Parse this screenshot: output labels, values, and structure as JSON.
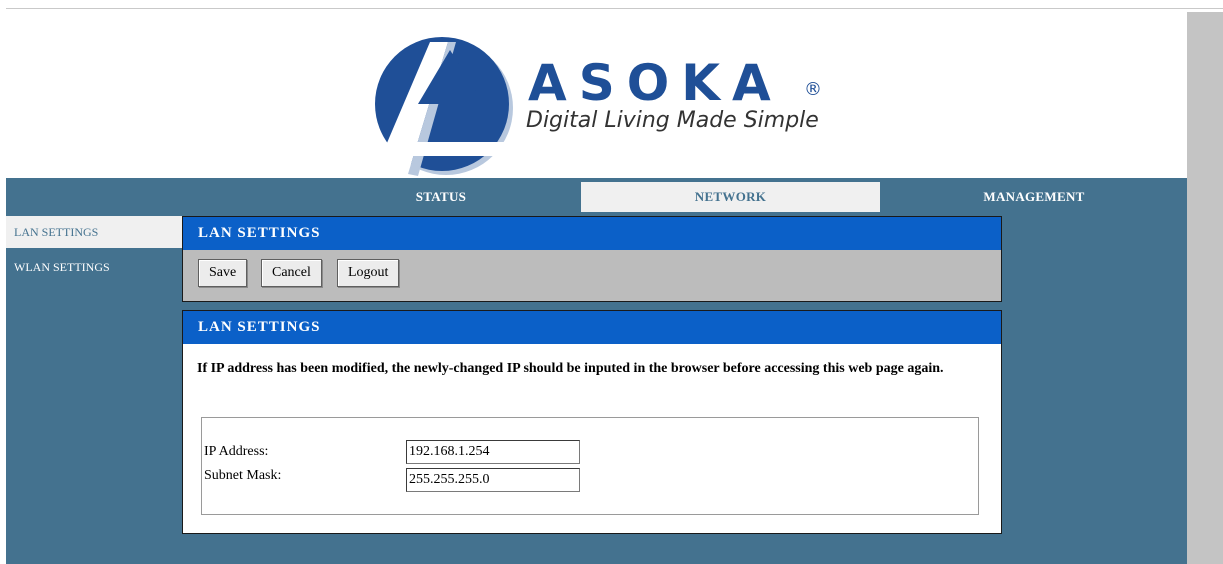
{
  "brand": {
    "name": "ASOKA",
    "registered": "®",
    "tagline": "Digital Living Made Simple",
    "primary_color": "#1f4f97",
    "shadow_color": "#b8c8de"
  },
  "nav": {
    "tabs": [
      {
        "label": "STATUS",
        "active": false
      },
      {
        "label": "NETWORK",
        "active": true
      },
      {
        "label": "MANAGEMENT",
        "active": false
      }
    ]
  },
  "sidebar": {
    "items": [
      {
        "label": "LAN SETTINGS",
        "active": true
      },
      {
        "label": "WLAN SETTINGS",
        "active": false
      }
    ]
  },
  "toolbar": {
    "title": "LAN SETTINGS",
    "save_label": "Save",
    "cancel_label": "Cancel",
    "logout_label": "Logout"
  },
  "settings": {
    "title": "LAN SETTINGS",
    "notice": "If IP address has been modified, the newly-changed IP should be inputed in the browser before accessing this web page again.",
    "ip_label": "IP Address:",
    "ip_value": "192.168.1.254",
    "mask_label": "Subnet Mask:",
    "mask_value": "255.255.255.0"
  },
  "colors": {
    "nav_bg": "#44728f",
    "header_bar": "#0b60c8",
    "toolbar_bg": "#bcbcbc",
    "active_tab_bg": "#f0f0f0"
  }
}
